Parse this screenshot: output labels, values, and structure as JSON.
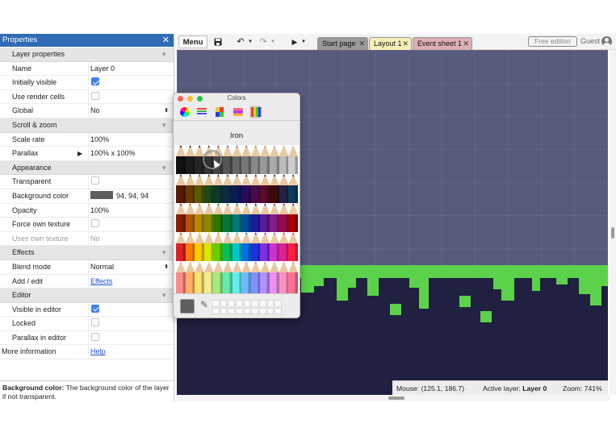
{
  "properties_panel": {
    "title": "Properties",
    "sections": [
      {
        "title": "Layer properties",
        "rows": [
          {
            "key": "name",
            "label": "Name",
            "value": "Layer 0",
            "type": "text"
          },
          {
            "key": "initially_visible",
            "label": "Initially visible",
            "checked": true,
            "type": "checkbox"
          },
          {
            "key": "use_render_cells",
            "label": "Use render cells",
            "checked": false,
            "type": "checkbox"
          },
          {
            "key": "global",
            "label": "Global",
            "value": "No",
            "type": "select"
          }
        ]
      },
      {
        "title": "Scroll & zoom",
        "rows": [
          {
            "key": "scale_rate",
            "label": "Scale rate",
            "value": "100%",
            "type": "text"
          },
          {
            "key": "parallax",
            "label": "Parallax",
            "value": "100% x 100%",
            "type": "expandable"
          }
        ]
      },
      {
        "title": "Appearance",
        "rows": [
          {
            "key": "transparent",
            "label": "Transparent",
            "checked": false,
            "type": "checkbox"
          },
          {
            "key": "background_color",
            "label": "Background color",
            "value": "94, 94, 94",
            "swatch": "#5e5e5e",
            "type": "color"
          },
          {
            "key": "opacity",
            "label": "Opacity",
            "value": "100%",
            "type": "text"
          },
          {
            "key": "force_own_texture",
            "label": "Force own texture",
            "checked": false,
            "type": "checkbox"
          },
          {
            "key": "uses_own_texture",
            "label": "Uses own texture",
            "value": "No",
            "type": "disabled"
          }
        ]
      },
      {
        "title": "Effects",
        "rows": [
          {
            "key": "blend_mode",
            "label": "Blend mode",
            "value": "Normal",
            "type": "select"
          },
          {
            "key": "add_edit",
            "label": "Add / edit",
            "value": "Effects",
            "type": "link"
          }
        ]
      },
      {
        "title": "Editor",
        "rows": [
          {
            "key": "visible_in_editor",
            "label": "Visible in editor",
            "checked": true,
            "type": "checkbox"
          },
          {
            "key": "locked",
            "label": "Locked",
            "checked": false,
            "type": "checkbox"
          },
          {
            "key": "parallax_in_editor",
            "label": "Parallax in editor",
            "checked": false,
            "type": "checkbox"
          }
        ]
      }
    ],
    "more_information": {
      "label": "More information",
      "value": "Help"
    },
    "help_text": {
      "title": "Background color:",
      "body": "The background color of the layer if not transparent."
    }
  },
  "toolbar": {
    "menu_label": "Menu",
    "save_icon": "save-icon",
    "undo_icon": "undo-icon",
    "redo_icon": "redo-icon",
    "play_icon": "play-icon",
    "tabs": [
      {
        "label": "Start page",
        "color": "#9a9a9a"
      },
      {
        "label": "Layout 1",
        "color": "#f6f0b8",
        "active": true
      },
      {
        "label": "Event sheet 1",
        "color": "#dcaeb6"
      }
    ],
    "free_edition": "Free edition",
    "user": "Guest"
  },
  "colors_window": {
    "title": "Colors",
    "tabs": [
      "color-wheel",
      "color-sliders",
      "color-palettes",
      "image-palettes",
      "pencils"
    ],
    "selected_pencil": "Iron",
    "current_color": "#5e5e5e"
  },
  "status_bar": {
    "mouse": "Mouse: (125.1, 186.7)",
    "active_layer_label": "Active layer:",
    "active_layer": "Layer 0",
    "zoom": "Zoom: 741%"
  },
  "canvas": {
    "background": "#585b7e",
    "ground": "#202040",
    "grass": "#5cd24a"
  }
}
